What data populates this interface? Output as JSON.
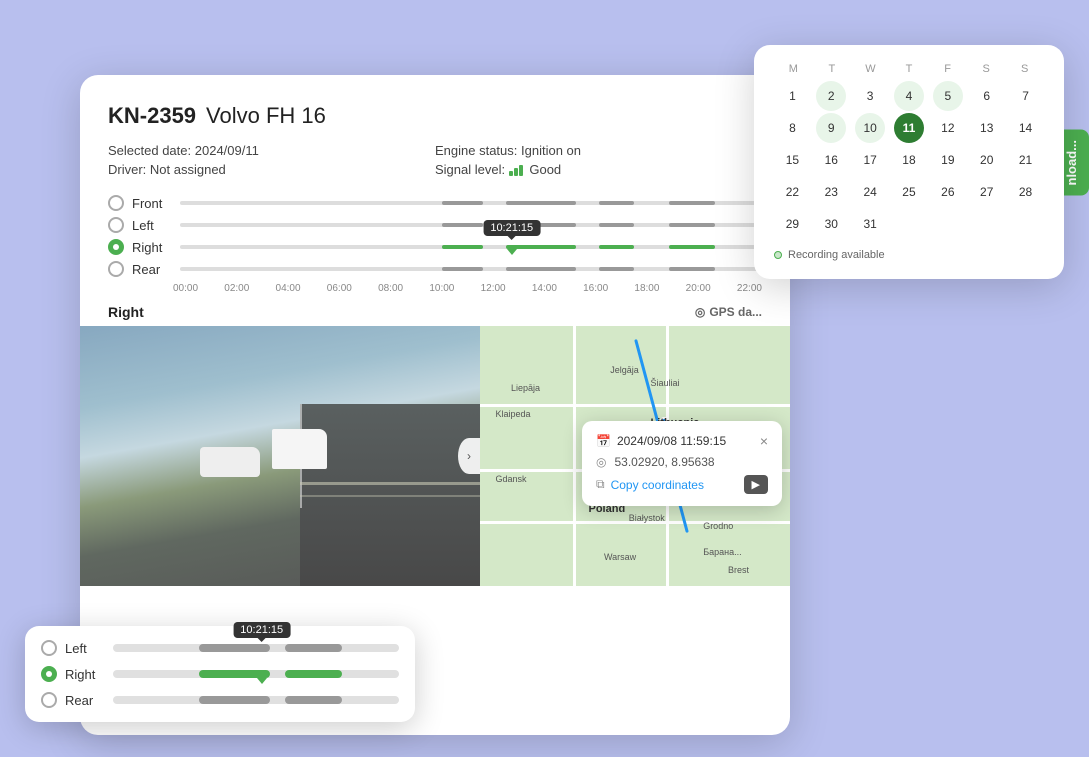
{
  "vehicle": {
    "id": "KN-2359",
    "model": "Volvo FH 16",
    "selected_date_label": "Selected date:",
    "selected_date_value": "2024/09/11",
    "driver_label": "Driver:",
    "driver_value": "Not assigned",
    "engine_status_label": "Engine status:",
    "engine_status_value": "Ignition on",
    "signal_level_label": "Signal level:",
    "signal_level_value": "Good"
  },
  "timeline": {
    "cameras": [
      {
        "id": "front",
        "label": "Front",
        "active": false
      },
      {
        "id": "left",
        "label": "Left",
        "active": false
      },
      {
        "id": "right",
        "label": "Right",
        "active": true
      },
      {
        "id": "rear",
        "label": "Rear",
        "active": false
      }
    ],
    "time_marks": [
      "00:00",
      "02:00",
      "04:00",
      "06:00",
      "08:00",
      "10:00",
      "12:00",
      "14:00",
      "16:00",
      "18:00",
      "20:00",
      "22:00"
    ],
    "current_time": "10:21:15"
  },
  "section": {
    "camera_label": "Right",
    "gps_label": "GPS da..."
  },
  "calendar": {
    "days_header": [
      "M",
      "T",
      "W",
      "T",
      "F",
      "S",
      "S"
    ],
    "weeks": [
      [
        {
          "n": "1",
          "state": ""
        },
        {
          "n": "2",
          "state": "has-data"
        },
        {
          "n": "3",
          "state": ""
        },
        {
          "n": "4",
          "state": "has-data"
        },
        {
          "n": "5",
          "state": "has-data"
        },
        {
          "n": "6",
          "state": ""
        },
        {
          "n": "7",
          "state": ""
        }
      ],
      [
        {
          "n": "8",
          "state": ""
        },
        {
          "n": "9",
          "state": "has-data"
        },
        {
          "n": "10",
          "state": "has-data"
        },
        {
          "n": "11",
          "state": "today"
        },
        {
          "n": "12",
          "state": ""
        },
        {
          "n": "13",
          "state": ""
        },
        {
          "n": "14",
          "state": ""
        }
      ],
      [
        {
          "n": "15",
          "state": ""
        },
        {
          "n": "16",
          "state": ""
        },
        {
          "n": "17",
          "state": ""
        },
        {
          "n": "18",
          "state": ""
        },
        {
          "n": "19",
          "state": ""
        },
        {
          "n": "20",
          "state": ""
        },
        {
          "n": "21",
          "state": ""
        }
      ],
      [
        {
          "n": "22",
          "state": ""
        },
        {
          "n": "23",
          "state": ""
        },
        {
          "n": "24",
          "state": ""
        },
        {
          "n": "25",
          "state": ""
        },
        {
          "n": "26",
          "state": ""
        },
        {
          "n": "27",
          "state": ""
        },
        {
          "n": "28",
          "state": ""
        }
      ],
      [
        {
          "n": "29",
          "state": ""
        },
        {
          "n": "30",
          "state": ""
        },
        {
          "n": "31",
          "state": ""
        }
      ]
    ],
    "legend": "Recording available"
  },
  "download_btn_label": "nload...",
  "gps_popup": {
    "datetime": "2024/09/08 11:59:15",
    "coordinates": "53.02920, 8.95638",
    "copy_label": "Copy coordinates",
    "close_label": "×",
    "play_label": "▶"
  },
  "mini_timeline": {
    "cameras": [
      {
        "label": "Left",
        "active": false
      },
      {
        "label": "Right",
        "active": true
      },
      {
        "label": "Rear",
        "active": false
      }
    ],
    "current_time": "10:21:15"
  },
  "icons": {
    "gps": "⊙",
    "calendar": "📅",
    "copy": "⧉",
    "location_pin": "◎"
  }
}
